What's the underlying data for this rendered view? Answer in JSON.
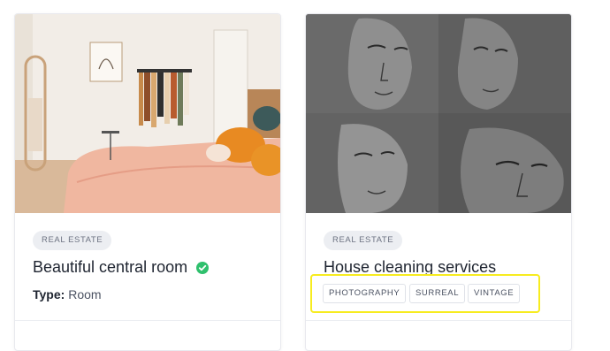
{
  "cards": [
    {
      "category": "REAL ESTATE",
      "title": "Beautiful central room",
      "verified_icon": "check-circle-icon",
      "meta_label": "Type:",
      "meta_value": "Room",
      "image": "bedroom-photo"
    },
    {
      "category": "REAL ESTATE",
      "title": "House cleaning services",
      "tags": [
        "PHOTOGRAPHY",
        "SURREAL",
        "VINTAGE"
      ],
      "image": "portrait-sketches-artwork"
    }
  ],
  "colors": {
    "verified": "#2fc06d",
    "highlight": "#f7ec1f",
    "badge_bg": "#eceef2",
    "title": "#1e2430"
  }
}
